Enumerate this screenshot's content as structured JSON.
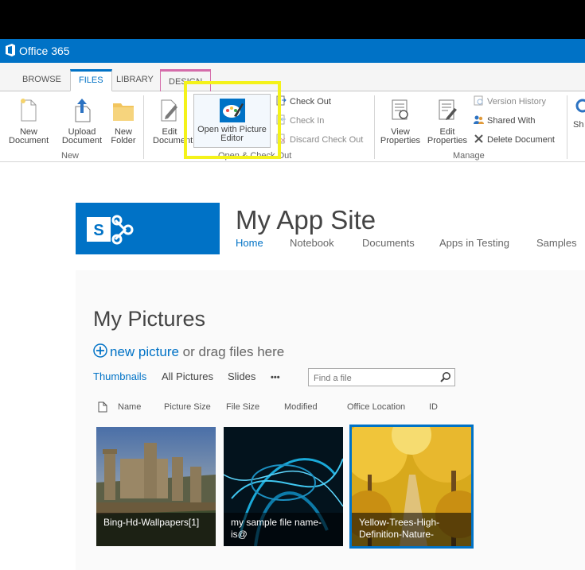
{
  "suite": {
    "brand": "Office 365"
  },
  "tabs": [
    {
      "label": "BROWSE"
    },
    {
      "label": "FILES"
    },
    {
      "label": "LIBRARY"
    },
    {
      "label": "DESIGN"
    }
  ],
  "ribbon": {
    "new_document": "New Document",
    "upload_document": "Upload Document",
    "new_folder": "New Folder",
    "group_new": "New",
    "edit_document": "Edit Document",
    "open_with_picture_editor": "Open with Picture Editor",
    "check_out": "Check Out",
    "check_in": "Check In",
    "discard_check_out": "Discard Check Out",
    "group_open_checkout": "Open & Check Out",
    "view_properties": "View Properties",
    "edit_properties": "Edit Properties",
    "version_history": "Version History",
    "shared_with": "Shared With",
    "delete_document": "Delete Document",
    "group_manage": "Manage",
    "share_partial": "Sh"
  },
  "site": {
    "title": "My App Site",
    "nav": [
      "Home",
      "Notebook",
      "Documents",
      "Apps in Testing",
      "Samples"
    ]
  },
  "library": {
    "title": "My Pictures",
    "new_link": "new picture",
    "new_rest": " or drag files here",
    "views": [
      "Thumbnails",
      "All Pictures",
      "Slides",
      "•••"
    ],
    "search_placeholder": "Find a file",
    "columns": [
      "Name",
      "Picture Size",
      "File Size",
      "Modified",
      "Office Location",
      "ID"
    ],
    "pictures": [
      {
        "caption": "Bing-Hd-Wallpapers[1]"
      },
      {
        "caption": "my sample file name-is@"
      },
      {
        "caption": "Yellow-Trees-High-Definition-Nature-"
      }
    ]
  },
  "colors": {
    "accent": "#0072c6",
    "highlight": "#f4f21a",
    "design_tab": "#d56caa"
  }
}
